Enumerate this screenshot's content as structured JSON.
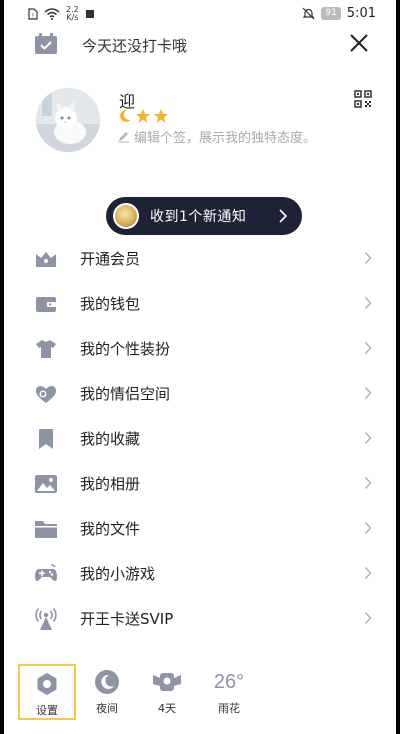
{
  "status_bar": {
    "net_speed_value": "2.2",
    "net_speed_unit": "K/s",
    "battery": "91",
    "time": "5:01"
  },
  "header": {
    "punch_text": "今天还没打卡哦"
  },
  "profile": {
    "username": "迎",
    "signature": "编辑个签，展示我的独特态度。"
  },
  "notification": {
    "text": "收到1个新通知"
  },
  "menu": [
    {
      "label": "开通会员",
      "icon": "crown-icon"
    },
    {
      "label": "我的钱包",
      "icon": "wallet-icon"
    },
    {
      "label": "我的个性装扮",
      "icon": "shirt-icon"
    },
    {
      "label": "我的情侣空间",
      "icon": "hearts-icon"
    },
    {
      "label": "我的收藏",
      "icon": "bookmark-icon"
    },
    {
      "label": "我的相册",
      "icon": "photo-icon"
    },
    {
      "label": "我的文件",
      "icon": "folder-icon"
    },
    {
      "label": "我的小游戏",
      "icon": "gamepad-icon"
    },
    {
      "label": "开王卡送SVIP",
      "icon": "signal-tower-icon"
    }
  ],
  "bottom_bar": {
    "settings": "设置",
    "night": "夜间",
    "days_badge": "4天",
    "temperature": "26°",
    "weather": "雨花"
  },
  "colors": {
    "icon_gray": "#8e94a6",
    "pill_bg": "#1e2236",
    "active_border": "#f3c84b"
  }
}
